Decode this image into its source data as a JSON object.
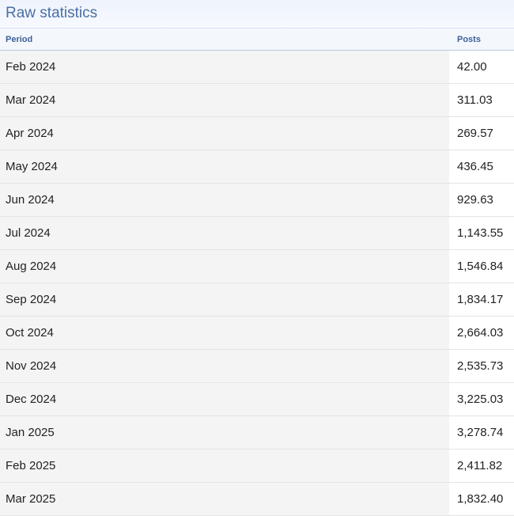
{
  "panel": {
    "title": "Raw statistics"
  },
  "table": {
    "columns": {
      "period": "Period",
      "posts": "Posts"
    },
    "rows": [
      {
        "period": "Feb 2024",
        "posts": "42.00"
      },
      {
        "period": "Mar 2024",
        "posts": "311.03"
      },
      {
        "period": "Apr 2024",
        "posts": "269.57"
      },
      {
        "period": "May 2024",
        "posts": "436.45"
      },
      {
        "period": "Jun 2024",
        "posts": "929.63"
      },
      {
        "period": "Jul 2024",
        "posts": "1,143.55"
      },
      {
        "period": "Aug 2024",
        "posts": "1,546.84"
      },
      {
        "period": "Sep 2024",
        "posts": "1,834.17"
      },
      {
        "period": "Oct 2024",
        "posts": "2,664.03"
      },
      {
        "period": "Nov 2024",
        "posts": "2,535.73"
      },
      {
        "period": "Dec 2024",
        "posts": "3,225.03"
      },
      {
        "period": "Jan 2025",
        "posts": "3,278.74"
      },
      {
        "period": "Feb 2025",
        "posts": "2,411.82"
      },
      {
        "period": "Mar 2025",
        "posts": "1,832.40"
      }
    ]
  }
}
